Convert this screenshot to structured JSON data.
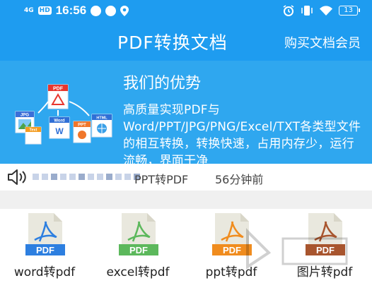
{
  "status_bar": {
    "network": "4G",
    "hd": "HD",
    "time": "16:56",
    "battery": "13"
  },
  "header": {
    "title": "PDF转换文档",
    "buy_vip": "购买文档会员"
  },
  "banner": {
    "heading": "我们的优势",
    "description": "高质量实现PDF与Word/PPT/JPG/PNG/Excel/TXT各类型文件的相互转换，转换快速，占用内存少，运行流畅，界面干净",
    "art_labels": {
      "pdf": "PDF",
      "jpg": "JPG",
      "word": "Word",
      "ppt": "PPT",
      "html": "HTML",
      "text": "Text"
    }
  },
  "notice": {
    "text": "PPT转PDF",
    "time": "56分钟前"
  },
  "tools": [
    {
      "label": "word转pdf",
      "badge": "PDF",
      "color": "#2d7fe0"
    },
    {
      "label": "excel转pdf",
      "badge": "PDF",
      "color": "#5cb85c"
    },
    {
      "label": "ppt转pdf",
      "badge": "PDF",
      "color": "#f08c1e"
    },
    {
      "label": "图片转pdf",
      "badge": "PDF",
      "color": "#a8552e"
    }
  ]
}
